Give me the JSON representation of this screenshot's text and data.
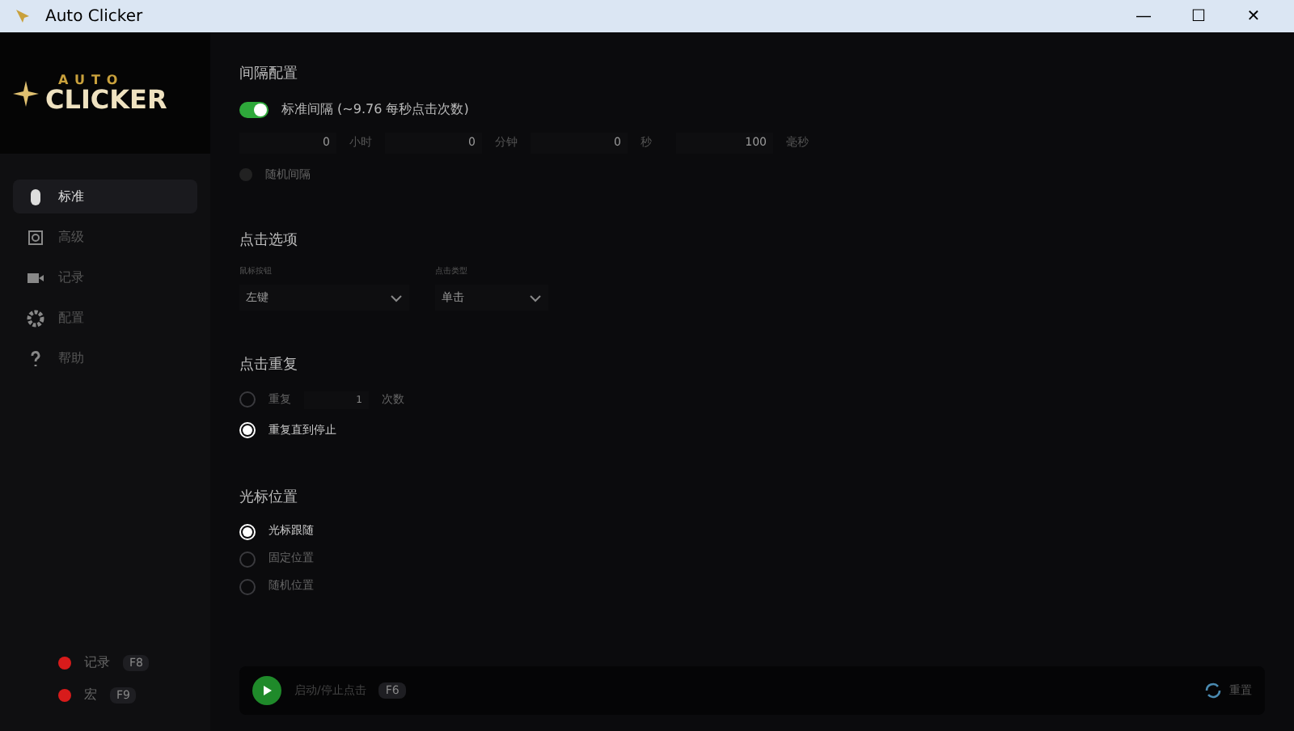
{
  "window": {
    "title": "Auto Clicker",
    "controls": [
      "—",
      "☐",
      "✕"
    ]
  },
  "logo": {
    "top": "AUTO",
    "bottom": "CLICKER"
  },
  "sidebar": {
    "items": [
      {
        "label": "标准",
        "kind": "mouse",
        "selected": true
      },
      {
        "label": "高级",
        "kind": "target",
        "selected": false
      },
      {
        "label": "记录",
        "kind": "camera",
        "selected": false
      },
      {
        "label": "配置",
        "kind": "gear",
        "selected": false
      },
      {
        "label": "帮助",
        "kind": "help",
        "selected": false
      }
    ],
    "status": [
      {
        "label": "记录",
        "key": "F8",
        "color": "#d81b1b"
      },
      {
        "label": "宏",
        "key": "F9",
        "color": "#d81b1b"
      }
    ]
  },
  "interval": {
    "title": "间隔配置",
    "toggle": {
      "label": "标准间隔 (~9.76 每秒点击次数)",
      "on": true
    },
    "fields": [
      {
        "value": "0",
        "unit": "小时"
      },
      {
        "value": "0",
        "unit": "分钟"
      },
      {
        "value": "0",
        "unit": "秒"
      },
      {
        "value": "100",
        "unit": "毫秒"
      }
    ],
    "random": {
      "label": "随机间隔",
      "checked": false
    }
  },
  "click_options": {
    "title": "点击选项",
    "dropdowns": [
      {
        "label": "鼠标按钮",
        "value": "左键"
      },
      {
        "label": "点击类型",
        "value": "单击"
      }
    ]
  },
  "repeat": {
    "title": "点击重复",
    "options": [
      {
        "label": "重复",
        "value": "1",
        "suffix": "次数",
        "selected": false
      },
      {
        "label": "重复直到停止",
        "selected": true
      }
    ]
  },
  "cursor": {
    "title": "光标位置",
    "options": [
      {
        "label": "光标跟随",
        "selected": true
      },
      {
        "label": "固定位置",
        "selected": false
      },
      {
        "label": "随机位置",
        "selected": false
      }
    ]
  },
  "footer": {
    "start_label": "启动/停止点击",
    "key": "F6",
    "reset_label": "重置"
  }
}
